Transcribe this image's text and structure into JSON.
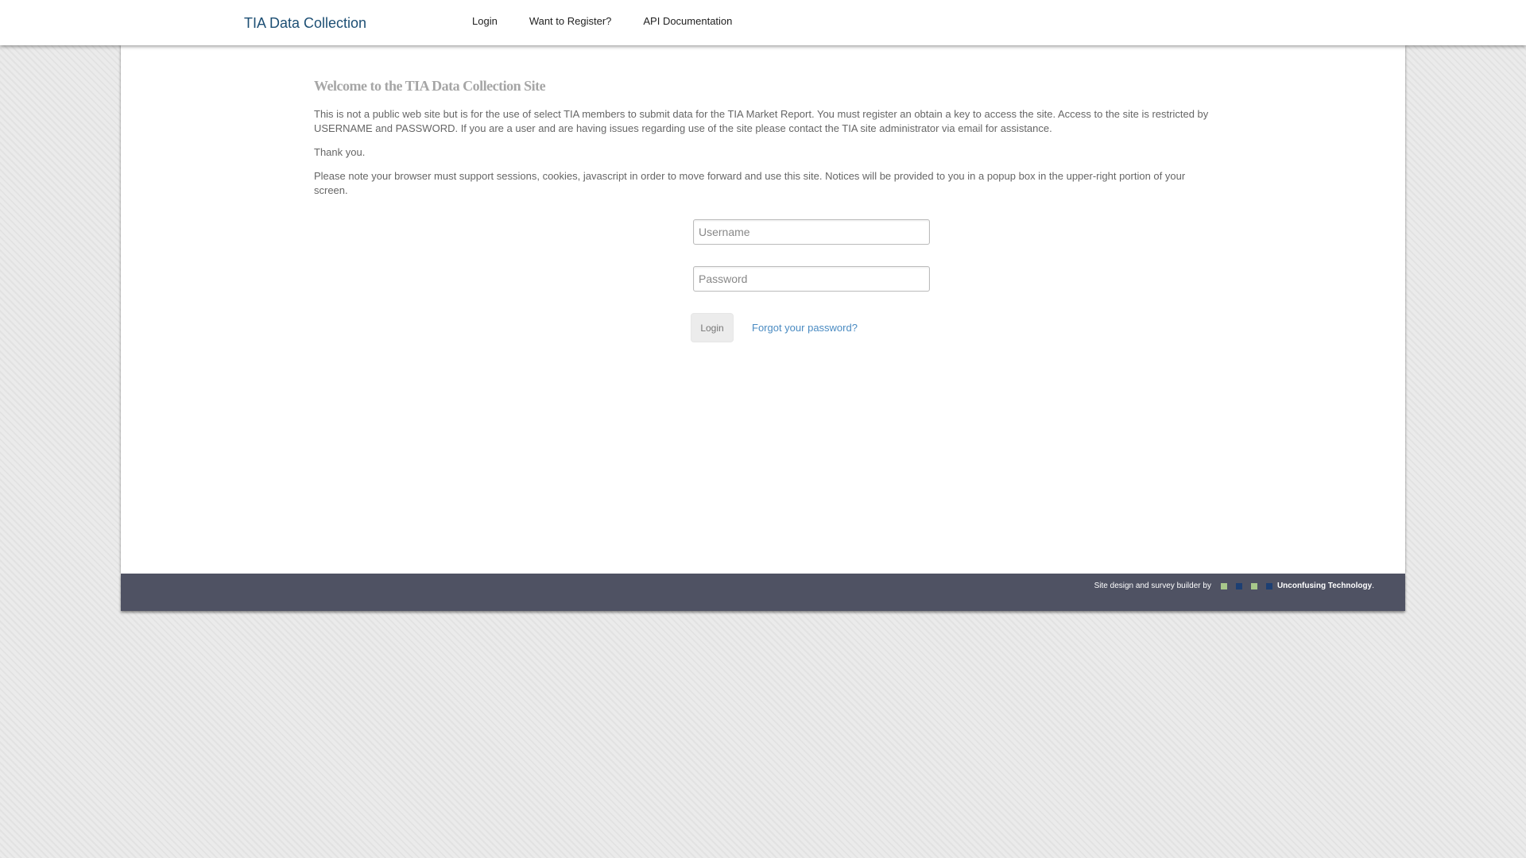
{
  "navbar": {
    "brand": "TIA Data Collection",
    "links": [
      "Login",
      "Want to Register?",
      "API Documentation"
    ]
  },
  "main": {
    "heading": "Welcome to the TIA Data Collection Site",
    "paragraphs": [
      "This is not a public web site but is for the use of select TIA members to submit data for the TIA Market Report. You must register an obtain a key to access the site. Access to the site is restricted by USERNAME and PASSWORD. If you are a user and are having issues regarding use of the site please contact the TIA site administrator via email for assistance.",
      "Thank you.",
      "Please note your browser must support sessions, cookies, javascript in order to move forward and use this site. Notices will be provided to you in a popup box in the upper-right portion of your screen."
    ]
  },
  "login_form": {
    "username_placeholder": "Username",
    "username_value": "",
    "password_placeholder": "Password",
    "password_value": "",
    "submit_label": "Login",
    "forgot_password_label": "Forgot your password?"
  },
  "footer": {
    "credit_text": "Site design and survey builder by",
    "company": "Unconfusing Technology",
    "suffix": ".",
    "square_colors": [
      "#a8c88a",
      "#1d3f73",
      "#a8c88a",
      "#1d3f73"
    ]
  },
  "colors": {
    "brand": "#1d4f74",
    "link": "#4a8bc2",
    "footer_bg": "#4f5263",
    "heading": "#a6a6a6"
  }
}
